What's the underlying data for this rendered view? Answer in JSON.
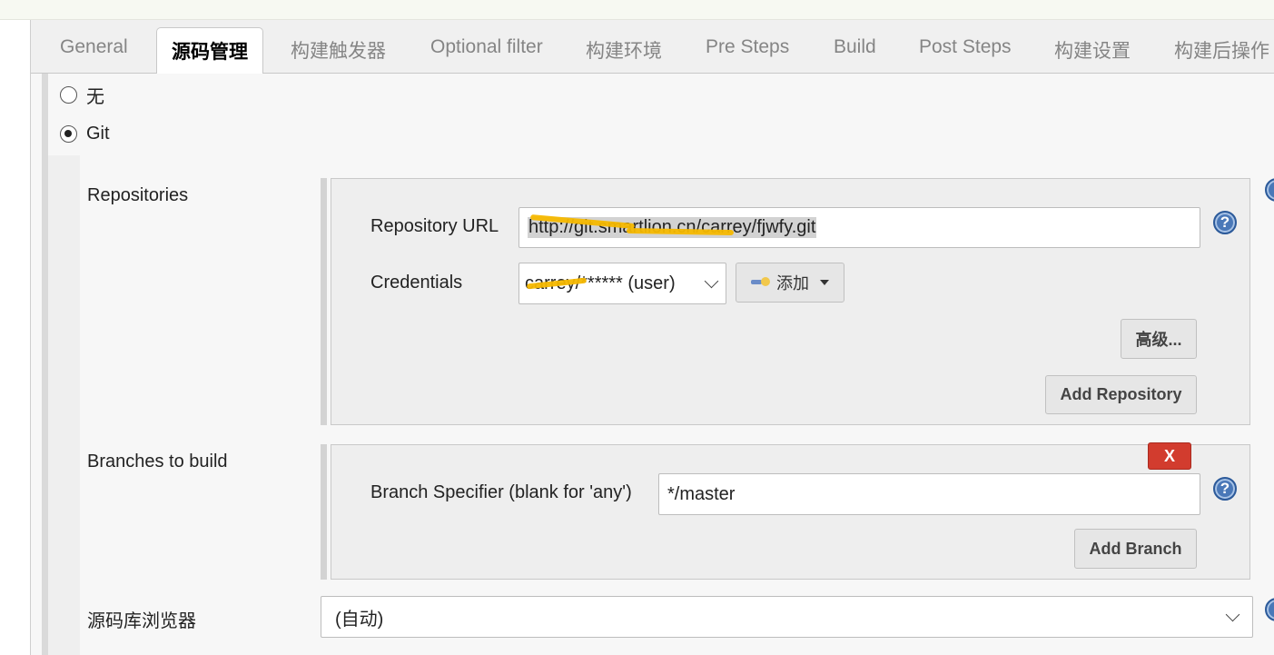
{
  "tabs": [
    {
      "label": "General"
    },
    {
      "label": "源码管理"
    },
    {
      "label": "构建触发器"
    },
    {
      "label": "Optional filter"
    },
    {
      "label": "构建环境"
    },
    {
      "label": "Pre Steps"
    },
    {
      "label": "Build"
    },
    {
      "label": "Post Steps"
    },
    {
      "label": "构建设置"
    },
    {
      "label": "构建后操作"
    }
  ],
  "scm": {
    "none_label": "无",
    "git_label": "Git",
    "selected": "Git"
  },
  "repositories": {
    "section_label": "Repositories",
    "url_label": "Repository URL",
    "url_value": "http://git.smartlion.cn/carrey/fjwfy.git",
    "credentials_label": "Credentials",
    "credentials_value": "carrey/****** (user)",
    "add_credentials_label": "添加",
    "advanced_label": "高级...",
    "add_repository_label": "Add Repository",
    "help_symbol": "?"
  },
  "branches": {
    "section_label": "Branches to build",
    "delete_label": "X",
    "specifier_label": "Branch Specifier (blank for 'any')",
    "specifier_value": "*/master",
    "add_branch_label": "Add Branch",
    "help_symbol": "?"
  },
  "browser": {
    "label": "源码库浏览器",
    "value": "(自动)"
  },
  "colors": {
    "accent_help": "#4a78b8",
    "delete_red": "#d23c2e",
    "redaction": "#f5b800"
  }
}
